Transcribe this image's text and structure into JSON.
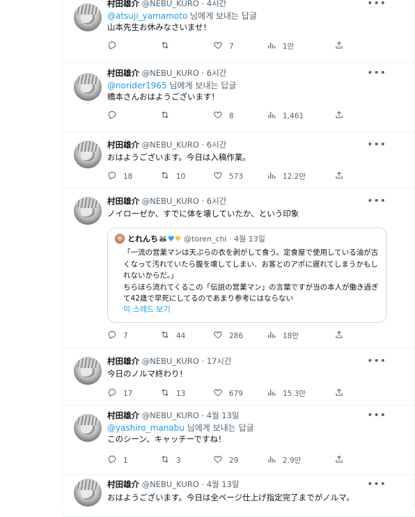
{
  "author": {
    "name": "村田雄介",
    "handle": "@NEBU_KURO"
  },
  "tweets": [
    {
      "time": "4시간",
      "reply_handle": "@atsuji_yamamoto",
      "reply_suffix": " 님에게 보내는 답글",
      "text": "山本先生お休みなさいませ！",
      "replies": "",
      "retweets": "",
      "likes": "7",
      "views": "1만"
    },
    {
      "time": "6시간",
      "reply_handle": "@norider1965",
      "reply_suffix": " 님에게 보내는 답글",
      "text": "橋本さんおはようございます！",
      "replies": "",
      "retweets": "",
      "likes": "8",
      "views": "1,461"
    },
    {
      "time": "6시간",
      "text": "おはようございます。今日は入稿作業。",
      "replies": "18",
      "retweets": "10",
      "likes": "573",
      "views": "12.2만"
    },
    {
      "time": "6시간",
      "text": "ノイローゼか、すでに体を壊していたか、という印象",
      "replies": "7",
      "retweets": "44",
      "likes": "286",
      "views": "18만",
      "quote": {
        "name": "とれんち",
        "name_emoji": "🦝",
        "handle": "@toren_chi",
        "date": "4월 13일",
        "text": "「一流の営業マンは天ぷらの衣を剥がして食う。定食屋で使用している油が古くなって汚れていたら腹を壊してしまい、お客とのアポに遅れてしまうかもしれないからだ。」\nちらほら流れてくるこの「伝説の営業マン」の言葉ですが当の本人が働き過ぎて42歳で早死にしてるのであまり参考にはならない",
        "thread_link": "이 스레드 보기"
      }
    },
    {
      "time": "17시간",
      "text": "今日のノルマ終わり！",
      "replies": "17",
      "retweets": "13",
      "likes": "679",
      "views": "15.3만"
    },
    {
      "time": "4월 13일",
      "reply_handle": "@yashiro_manabu",
      "reply_suffix": " 님에게 보내는 답글",
      "text": "このシーン、キャッチーですね！",
      "replies": "1",
      "retweets": "3",
      "likes": "29",
      "views": "2.9만"
    },
    {
      "time": "4월 13일",
      "text": "おはようございます。今日は全ページ仕上げ指定完了までがノルマ。"
    }
  ],
  "colors": {
    "link": "#1d9bf0",
    "muted": "#536471",
    "border": "#eff3f4"
  },
  "icons": {
    "more": "more-dots-icon",
    "reply": "reply-icon",
    "retweet": "retweet-icon",
    "like": "heart-icon",
    "views": "views-icon",
    "share": "share-icon"
  }
}
